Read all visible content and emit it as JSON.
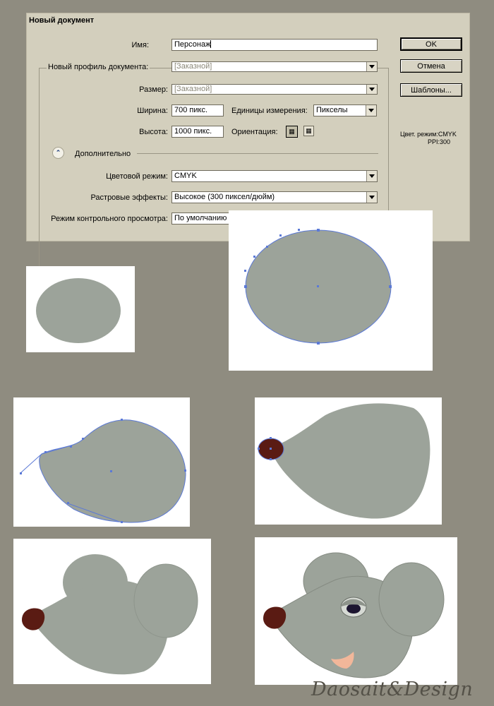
{
  "dialog": {
    "title": "Новый документ",
    "name_label": "Имя:",
    "name_value": "Персонаж",
    "profile_label": "Новый профиль документа:",
    "profile_value": "[Заказной]",
    "size_label": "Размер:",
    "size_value": "[Заказной]",
    "width_label": "Ширина:",
    "width_value": "700 пикс.",
    "units_label": "Единицы измерения:",
    "units_value": "Пикселы",
    "height_label": "Высота:",
    "height_value": "1000 пикс.",
    "orientation_label": "Ориентация:",
    "advanced_label": "Дополнительно",
    "color_mode_label": "Цветовой режим:",
    "color_mode_value": "CMYK",
    "raster_label": "Растровые эффекты:",
    "raster_value": "Высокое (300 пиксел/дюйм)",
    "preview_label": "Режим контрольного просмотра:",
    "preview_value": "По умолчанию",
    "ok_label": "OK",
    "cancel_label": "Отмена",
    "templates_label": "Шаблоны...",
    "info_color": "Цвет. режим:CMYK",
    "info_ppi": "PPI:300"
  },
  "colors": {
    "background": "#8f8c80",
    "dialog": "#d3cfbd",
    "shape_fill": "#9ca39a",
    "path_stroke": "#5b79d6",
    "nose": "#5a1b13",
    "pupil": "#1c1530",
    "tooth": "#f2b79a"
  },
  "icons": [
    "double-chevron-up-icon",
    "portrait-orientation-icon",
    "landscape-orientation-icon",
    "dropdown-arrow-icon"
  ],
  "watermark": "Daosait&Design"
}
